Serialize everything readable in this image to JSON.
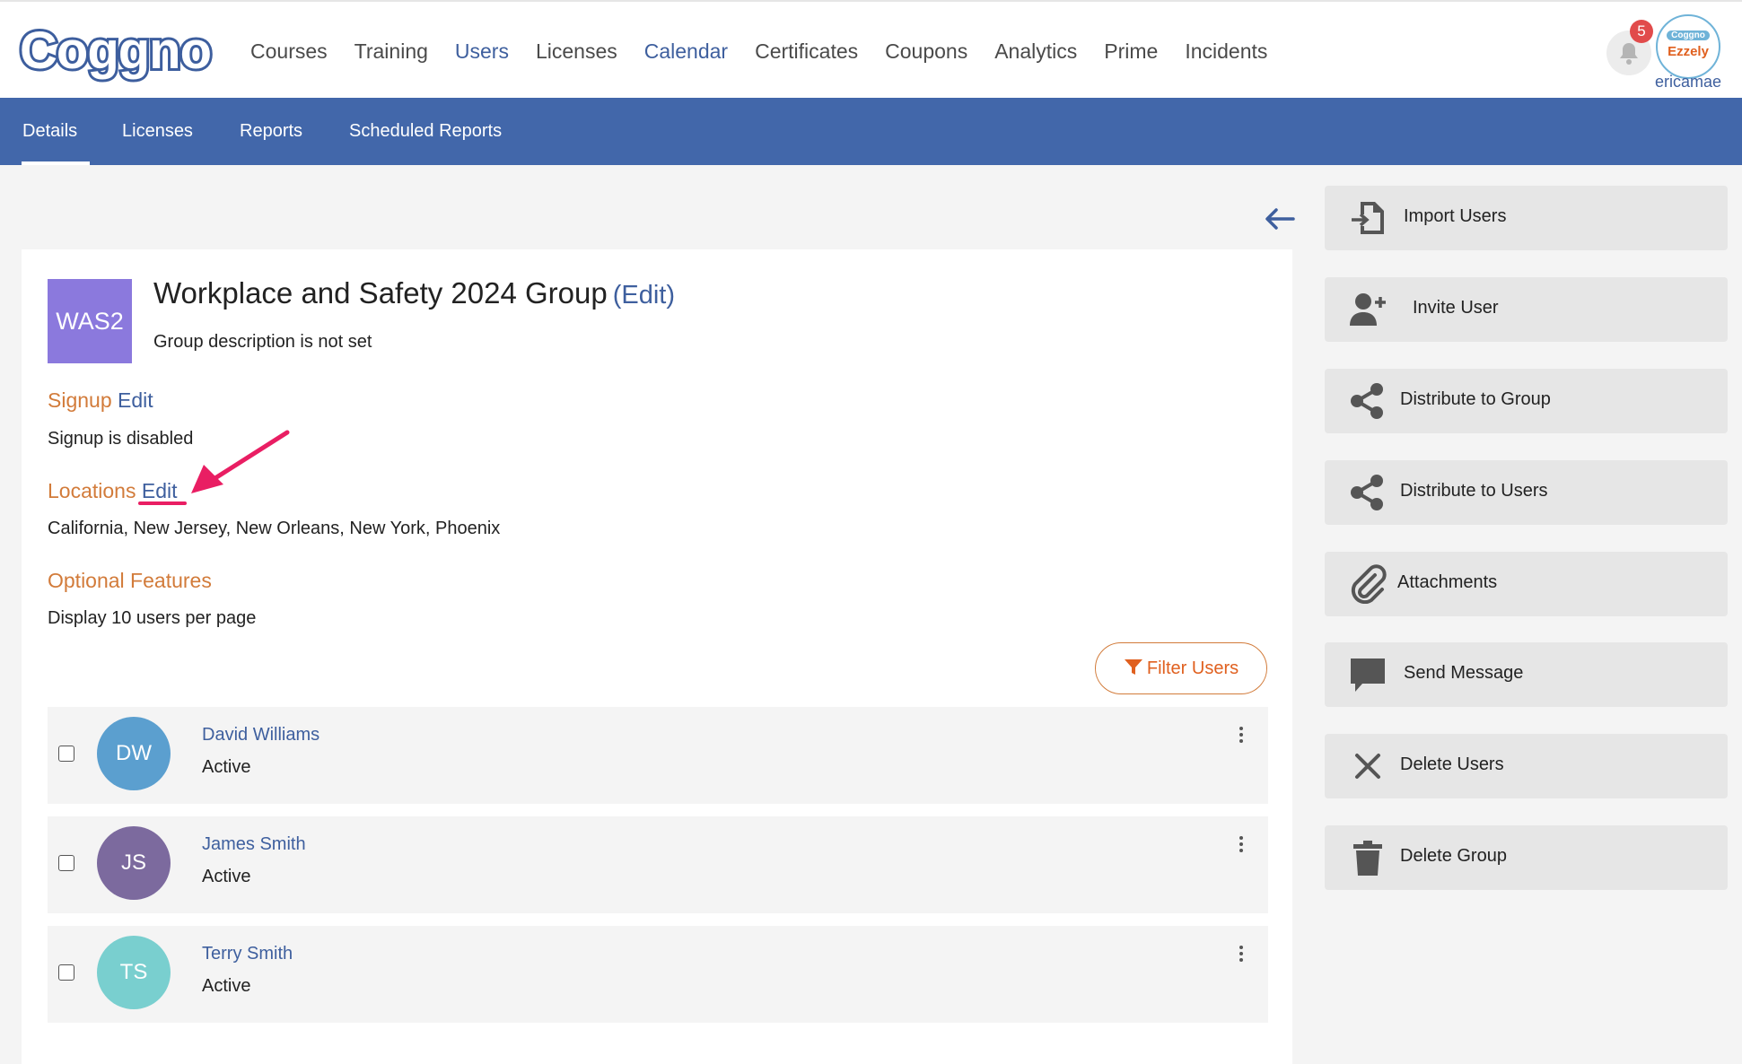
{
  "brand": {
    "logo": "Coggno"
  },
  "topnav": {
    "items": [
      "Courses",
      "Training",
      "Users",
      "Licenses",
      "Calendar",
      "Certificates",
      "Coupons",
      "Analytics",
      "Prime",
      "Incidents"
    ]
  },
  "notifications": {
    "count": "5"
  },
  "user": {
    "avatar_line1": "Coggno",
    "avatar_line2": "Ezzely",
    "username": "ericamae"
  },
  "subnav": {
    "tabs": [
      "Details",
      "Licenses",
      "Reports",
      "Scheduled Reports"
    ],
    "active": "Details"
  },
  "group": {
    "initials": "WAS2",
    "title": "Workplace and Safety 2024 Group",
    "edit_label": "(Edit)",
    "description": "Group description is not set"
  },
  "sections": {
    "signup": {
      "title": "Signup",
      "edit": "Edit",
      "text": "Signup is disabled"
    },
    "locations": {
      "title": "Locations",
      "edit": "Edit",
      "text": "California, New Jersey, New Orleans, New York, Phoenix"
    },
    "optional": {
      "title": "Optional Features",
      "text": "Display 10 users per page"
    }
  },
  "filter": {
    "label": "Filter Users"
  },
  "users": [
    {
      "initials": "DW",
      "name": "David Williams",
      "status": "Active",
      "color": "#5b9fcf"
    },
    {
      "initials": "JS",
      "name": "James Smith",
      "status": "Active",
      "color": "#7c6a9e"
    },
    {
      "initials": "TS",
      "name": "Terry Smith",
      "status": "Active",
      "color": "#79cfcf"
    }
  ],
  "actions": [
    {
      "label": "Import Users",
      "icon": "import-icon"
    },
    {
      "label": "Invite User",
      "icon": "user-plus-icon"
    },
    {
      "label": "Distribute to Group",
      "icon": "share-icon"
    },
    {
      "label": "Distribute to Users",
      "icon": "share-icon"
    },
    {
      "label": "Attachments",
      "icon": "paperclip-icon"
    },
    {
      "label": "Send Message",
      "icon": "message-icon"
    },
    {
      "label": "Delete Users",
      "icon": "close-icon"
    },
    {
      "label": "Delete Group",
      "icon": "trash-icon"
    }
  ],
  "colors": {
    "primary": "#4267aa",
    "link": "#3e5f9e",
    "section": "#d27b3a",
    "accent": "#e0601f",
    "annotation": "#e91e63"
  }
}
